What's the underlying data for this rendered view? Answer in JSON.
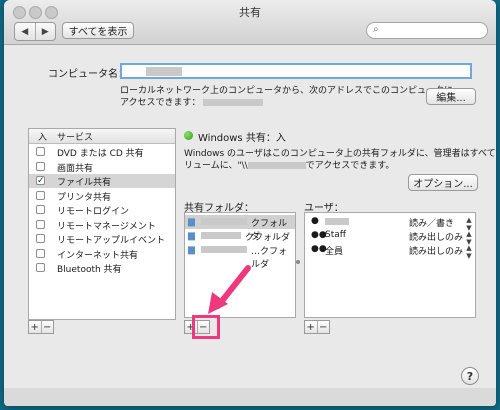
{
  "window": {
    "title": "共有"
  },
  "toolbar": {
    "back_glyph": "◀",
    "forward_glyph": "▶",
    "show_all_label": "すべてを表示",
    "search_placeholder": ""
  },
  "computer": {
    "name_label": "コンピュータ名：",
    "desc_line1": "ローカルネットワーク上のコンピュータから、次のアドレスでこのコンピュータに",
    "desc_line2": "アクセスできます：",
    "edit_label": "編集..."
  },
  "services": {
    "header_on": "入",
    "header_service": "サービス",
    "items": [
      {
        "label": "DVD または CD 共有",
        "checked": false
      },
      {
        "label": "画面共有",
        "checked": false
      },
      {
        "label": "ファイル共有",
        "checked": true
      },
      {
        "label": "プリンタ共有",
        "checked": false
      },
      {
        "label": "リモートログイン",
        "checked": false
      },
      {
        "label": "リモートマネージメント",
        "checked": false
      },
      {
        "label": "リモートアップルイベント",
        "checked": false
      },
      {
        "label": "インターネット共有",
        "checked": false
      },
      {
        "label": "Bluetooth 共有",
        "checked": false
      }
    ],
    "add_glyph": "+",
    "remove_glyph": "−"
  },
  "detail": {
    "status_title": "Windows 共有：入",
    "desc_line1": "Windows のユーザはこのコンピュータ上の共有フォルダに、管理者はすべてのボ",
    "desc_line2_prefix": "リュームに、\"\\\\",
    "desc_line2_suffix": "でアクセスできます。",
    "options_label": "オプション..."
  },
  "shared_folders": {
    "label": "共有フォルダ：",
    "items": [
      {
        "suffix": "クフォルダ"
      },
      {
        "suffix": "クフォルダ"
      },
      {
        "suffix": "…クフォルダ"
      }
    ]
  },
  "users": {
    "label": "ユーザ：",
    "items": [
      {
        "name": "",
        "perm": "読み／書き"
      },
      {
        "name": "Staff",
        "perm": "読み出しのみ"
      },
      {
        "name": "全員",
        "perm": "読み出しのみ"
      }
    ]
  },
  "help": {
    "glyph": "?"
  },
  "colors": {
    "highlight": "#ee3a7c",
    "status_green": "#2f9a17"
  }
}
